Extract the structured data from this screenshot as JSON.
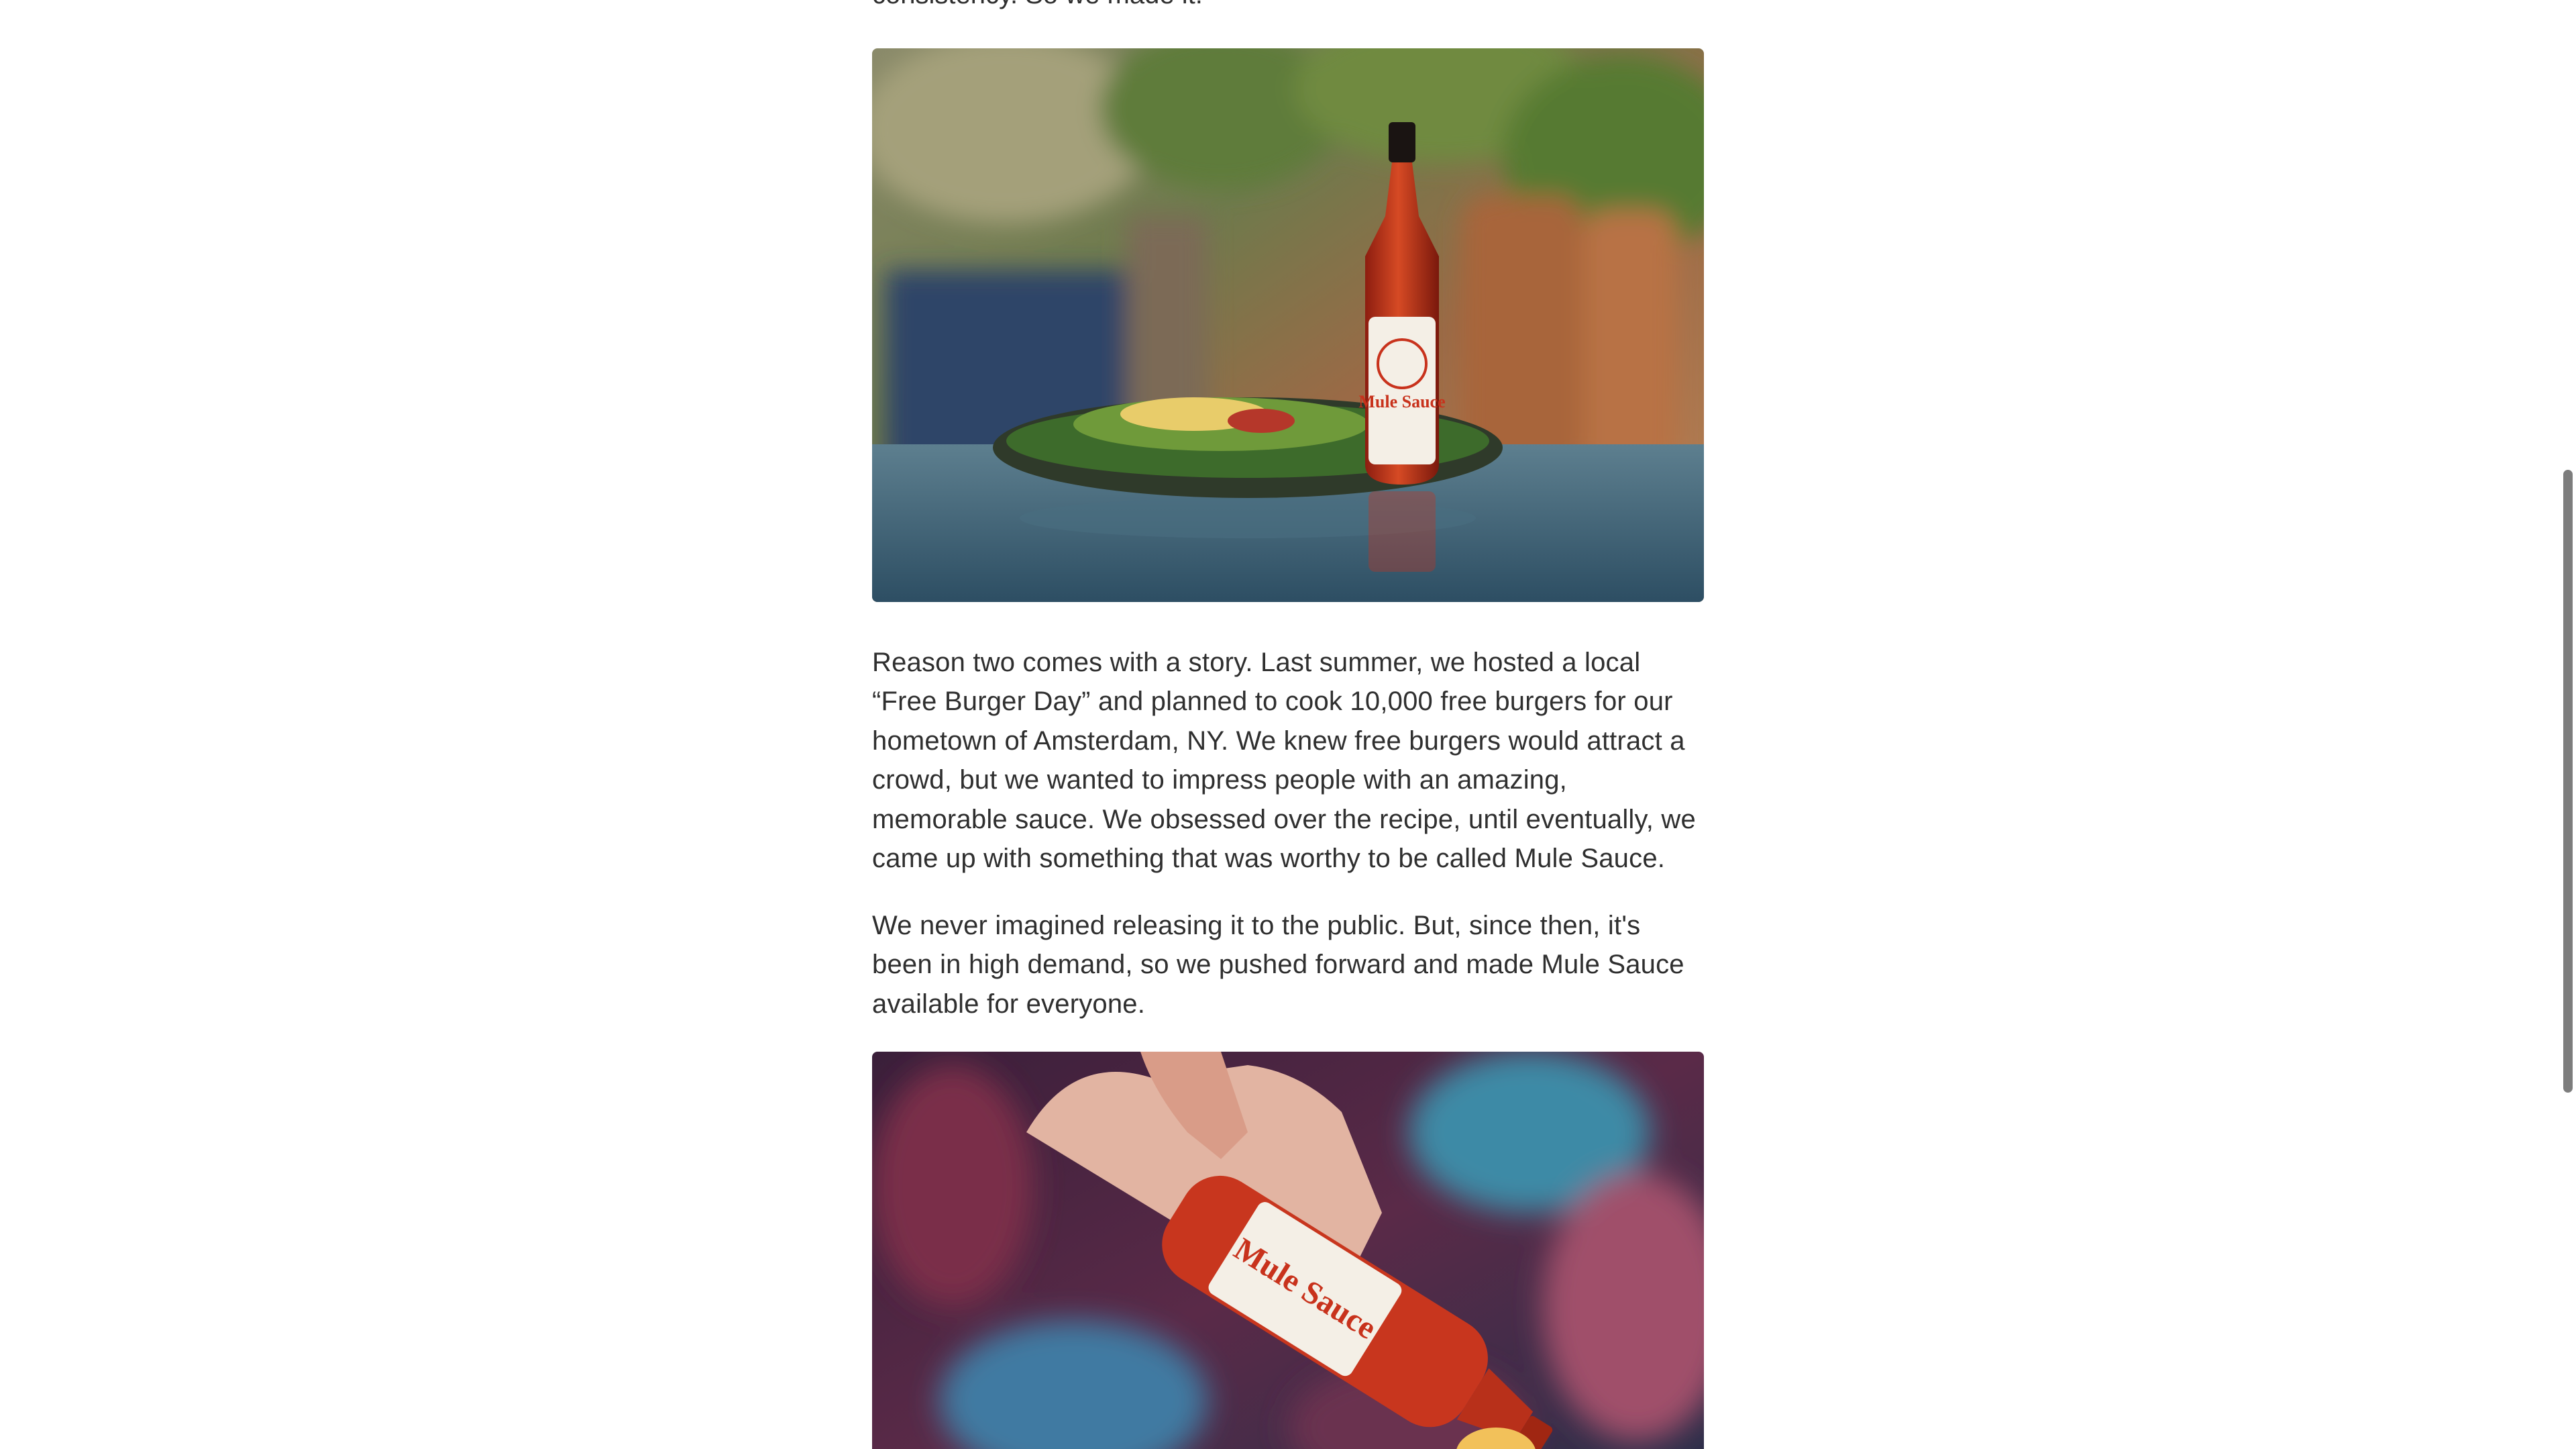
{
  "article": {
    "cutoff_text": "consistency. So we made it.",
    "paragraph_1": "Reason two comes with a story. Last summer, we hosted a local “Free Burger Day” and planned to cook 10,000 free burgers for our hometown of Amsterdam, NY. We knew free burgers would attract a crowd, but we wanted to impress people with an amazing, memorable sauce. We obsessed over the recipe, until eventually, we came up with something that was worthy to be called Mule Sauce.",
    "paragraph_2": "We never imagined releasing it to the public. But, since then, it's been in high demand, so we pushed forward and made Mule Sauce available for everyone.",
    "photo_1": {
      "label_text": "Mule Sauce"
    },
    "photo_2": {
      "label_text": "Mule Sauce"
    }
  },
  "colors": {
    "text": "#2f2f2f",
    "sauce_red": "#c8321c",
    "label_cream": "#f4efe6",
    "scroll_thumb": "#7d7d7d"
  }
}
